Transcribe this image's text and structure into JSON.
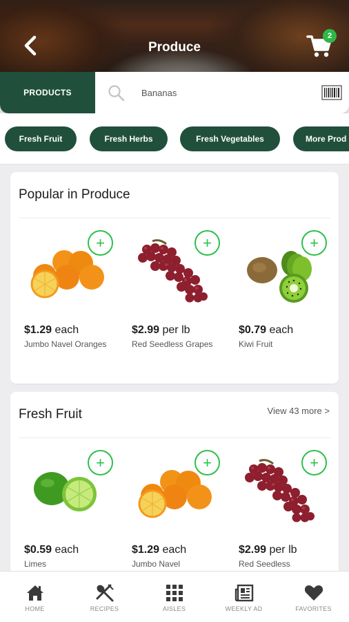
{
  "header": {
    "title": "Produce",
    "cart_count": "2"
  },
  "search": {
    "products_tab": "PRODUCTS",
    "query": "Bananas"
  },
  "chips": [
    "Fresh Fruit",
    "Fresh Herbs",
    "Fresh Vegetables",
    "More Prod"
  ],
  "popular": {
    "title": "Popular in Produce",
    "items": [
      {
        "price": "$1.29",
        "unit": " each",
        "name": "Jumbo Navel Oranges",
        "icon": "oranges"
      },
      {
        "price": "$2.99",
        "unit": " per lb",
        "name": "Red Seedless Grapes",
        "icon": "grapes"
      },
      {
        "price": "$0.79",
        "unit": " each",
        "name": "Kiwi Fruit",
        "icon": "kiwi"
      }
    ]
  },
  "fresh_fruit": {
    "title": "Fresh Fruit",
    "view_more": "View 43 more >",
    "items": [
      {
        "price": "$0.59",
        "unit": " each",
        "name": "Limes",
        "icon": "limes"
      },
      {
        "price": "$1.29",
        "unit": " each",
        "name": "Jumbo Navel",
        "icon": "oranges"
      },
      {
        "price": "$2.99",
        "unit": " per lb",
        "name": "Red Seedless",
        "icon": "grapes"
      }
    ]
  },
  "nav": [
    {
      "label": "HOME",
      "icon": "home-icon"
    },
    {
      "label": "RECIPES",
      "icon": "recipes-icon"
    },
    {
      "label": "AISLES",
      "icon": "aisles-icon"
    },
    {
      "label": "WEEKLY AD",
      "icon": "weekly-ad-icon"
    },
    {
      "label": "FAVORITES",
      "icon": "favorites-icon"
    }
  ],
  "colors": {
    "brand_green": "#20503b",
    "add_green": "#2bc04a",
    "badge_green": "#2fb84a"
  }
}
